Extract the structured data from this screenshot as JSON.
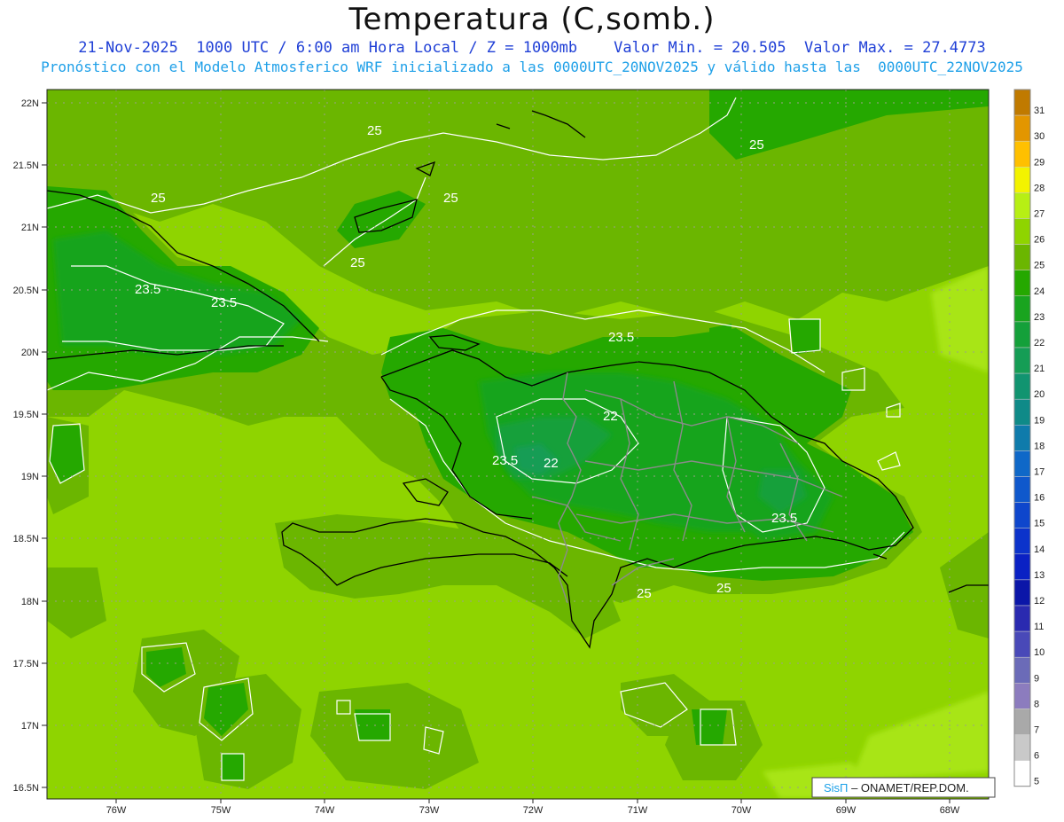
{
  "header": {
    "title": "Temperatura (C,somb.)",
    "subtitle_main": "21-Nov-2025  1000 UTC / 6:00 am Hora Local / Z = 1000mb",
    "subtitle_minmax": "Valor Min. = 20.505  Valor Max. = 27.4773",
    "subtitle_model": "Pronóstico con el Modelo Atmosferico WRF inicializado a las 0000UTC_20NOV2025 y válido hasta las  0000UTC_22NOV2025"
  },
  "axes": {
    "lat_labels": [
      "22N",
      "21.5N",
      "21N",
      "20.5N",
      "20N",
      "19.5N",
      "19N",
      "18.5N",
      "18N",
      "17.5N",
      "17N",
      "16.5N"
    ],
    "lon_labels": [
      "76W",
      "75W",
      "74W",
      "73W",
      "72W",
      "71W",
      "70W",
      "69W",
      "68W"
    ]
  },
  "colorbar": {
    "labels": [
      "31",
      "30",
      "29",
      "28",
      "27",
      "26",
      "25",
      "24",
      "23",
      "22",
      "21",
      "20",
      "19",
      "18",
      "17",
      "16",
      "15",
      "14",
      "13",
      "12",
      "11",
      "10",
      "9",
      "8",
      "7",
      "6",
      "5"
    ],
    "colors": [
      "#c07a00",
      "#e39600",
      "#ffc000",
      "#f3f300",
      "#b7ef14",
      "#8fd400",
      "#6bb600",
      "#25a800",
      "#19a41f",
      "#14a03a",
      "#159d55",
      "#119470",
      "#0f8a88",
      "#0f7bab",
      "#0f68c8",
      "#0f58cc",
      "#0e46cc",
      "#0c33cb",
      "#0a21c4",
      "#0b16a8",
      "#2a2ab0",
      "#4949b8",
      "#6b6bb8",
      "#8c7cbe",
      "#a9a9a9",
      "#c9c9c9",
      "#ffffff"
    ]
  },
  "contours": [
    "25",
    "25",
    "25",
    "25",
    "25",
    "23.5",
    "23.5",
    "23.5",
    "23.5",
    "23.5",
    "22",
    "22",
    "25",
    "25"
  ],
  "credit": {
    "brand": "SisΠ",
    "text": " – ONAMET/REP.DOM."
  }
}
